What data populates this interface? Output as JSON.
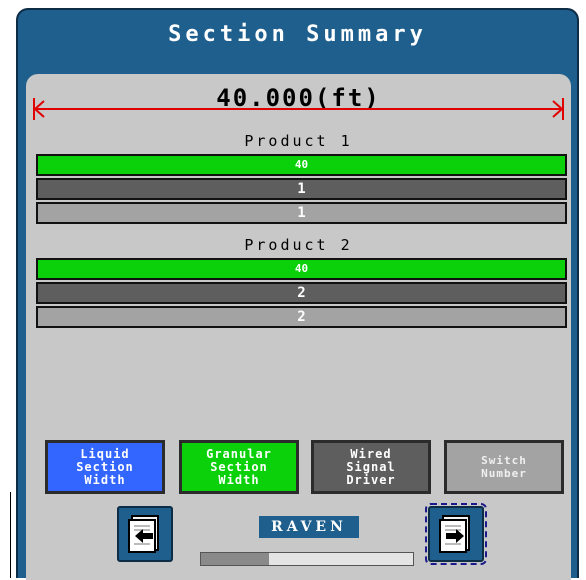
{
  "screen": {
    "title": "Section Summary",
    "total_width": "40.000(ft)"
  },
  "products": [
    {
      "label": "Product 1",
      "liquid_section_width": "40",
      "signal_driver": "1",
      "switch_number": "1"
    },
    {
      "label": "Product 2",
      "liquid_section_width": "40",
      "signal_driver": "2",
      "switch_number": "2"
    }
  ],
  "legend": {
    "liquid_section_width": "Liquid\nSection\nWidth",
    "granular_section_width": "Granular\nSection\nWidth",
    "wired_signal_driver": "Wired\nSignal\nDriver",
    "switch_number": "Switch\nNumber"
  },
  "colors": {
    "liquid": "#3366ff",
    "granular": "#0ad10a",
    "driver": "#5e5e5e",
    "switch": "#a3a3a3",
    "dimension_line": "#e00000",
    "header": "#1f5f8e"
  },
  "nav": {
    "back_icon": "page-back-icon",
    "forward_icon": "page-forward-icon"
  },
  "brand": {
    "logo_text": "RAVEN"
  },
  "progress": {
    "fraction": 0.32
  }
}
